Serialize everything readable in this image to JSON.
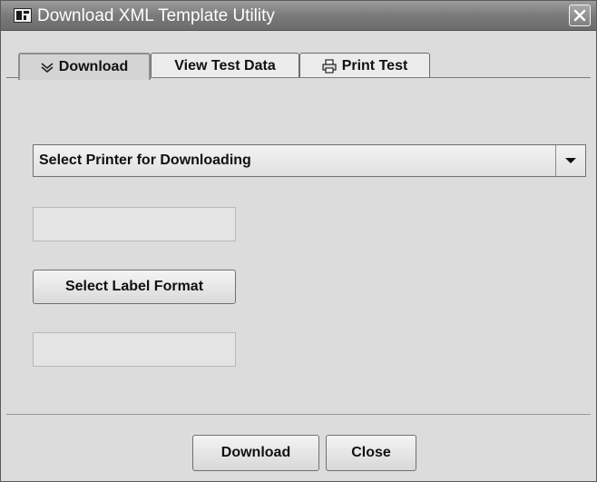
{
  "window": {
    "title": "Download XML Template Utility",
    "icons": {
      "app": "app-icon",
      "close": "close-icon"
    }
  },
  "tabs": [
    {
      "label": "Download",
      "icon": "chevron-down-icon",
      "active": true
    },
    {
      "label": "View Test Data",
      "active": false
    },
    {
      "label": "Print Test",
      "icon": "printer-icon",
      "active": false
    }
  ],
  "download_panel": {
    "printer_select": {
      "selected": "Select Printer for Downloading",
      "icon": "dropdown-arrow-icon"
    },
    "printer_field_value": "",
    "label_format_button": "Select Label Format",
    "label_format_field_value": ""
  },
  "footer": {
    "download_label": "Download",
    "close_label": "Close"
  },
  "colors": {
    "titlebar": "#7a7a7a",
    "background": "#dcdcdc"
  }
}
